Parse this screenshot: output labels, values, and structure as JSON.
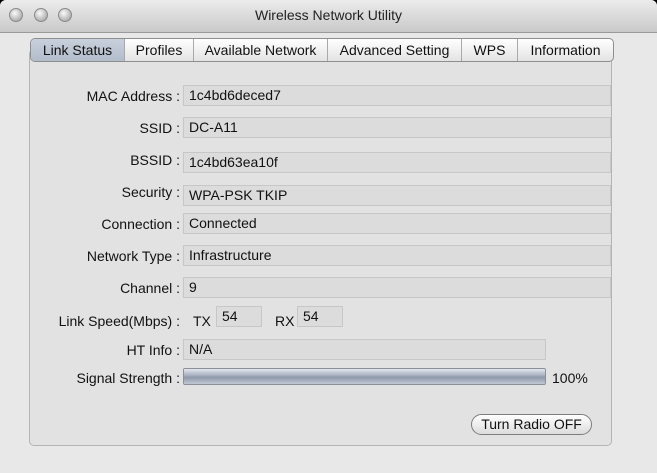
{
  "window": {
    "title": "Wireless Network Utility"
  },
  "tabs": [
    {
      "label": "Link Status"
    },
    {
      "label": "Profiles"
    },
    {
      "label": "Available Network"
    },
    {
      "label": "Advanced Setting"
    },
    {
      "label": "WPS"
    },
    {
      "label": "Information"
    }
  ],
  "fields": {
    "mac": {
      "label": "MAC Address :",
      "value": "1c4bd6deced7"
    },
    "ssid": {
      "label": "SSID :",
      "value": "DC-A11"
    },
    "bssid": {
      "label": "BSSID :",
      "value": "1c4bd63ea10f"
    },
    "security": {
      "label": "Security :",
      "value": "WPA-PSK TKIP"
    },
    "connection": {
      "label": "Connection :",
      "value": "Connected"
    },
    "network_type": {
      "label": "Network Type :",
      "value": "Infrastructure"
    },
    "channel": {
      "label": "Channel :",
      "value": "9"
    }
  },
  "link_speed": {
    "label": "Link Speed(Mbps) :",
    "tx_label": "TX",
    "tx": "54",
    "rx_label": "RX",
    "rx": "54"
  },
  "ht_info": {
    "label": "HT Info :",
    "value": "N/A"
  },
  "signal": {
    "label": "Signal Strength :",
    "value_text": "100%",
    "level": 1.0
  },
  "buttons": {
    "radio": "Turn Radio OFF"
  }
}
